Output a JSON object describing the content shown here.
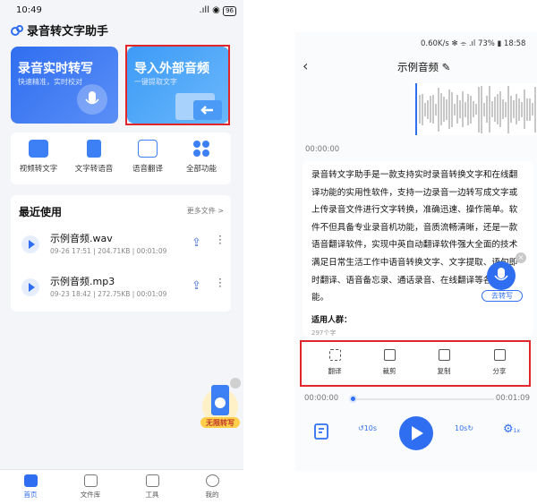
{
  "left": {
    "status": {
      "time": "10:49",
      "battery": "96"
    },
    "app_title": "录音转文字助手",
    "card_record": {
      "title": "录音实时转写",
      "subtitle": "快速精准，实时校对"
    },
    "card_import": {
      "title": "导入外部音频",
      "subtitle": "一键提取文字"
    },
    "tools": [
      {
        "label": "视频转文字",
        "icon": "video-icon"
      },
      {
        "label": "文字转语音",
        "icon": "text-to-speech-icon"
      },
      {
        "label": "语音翻译",
        "icon": "translate-icon"
      },
      {
        "label": "全部功能",
        "icon": "grid-icon"
      }
    ],
    "recent": {
      "title": "最近使用",
      "more": "更多文件 >",
      "items": [
        {
          "name": "示例音频.wav",
          "meta": "09-26 17:51 | 204.71KB | 00:01:09"
        },
        {
          "name": "示例音频.mp3",
          "meta": "09-23 18:42 | 272.75KB | 00:01:09"
        }
      ]
    },
    "promo": "无限转写",
    "nav": [
      {
        "label": "首页",
        "icon": "home-icon"
      },
      {
        "label": "文件库",
        "icon": "folder-icon"
      },
      {
        "label": "工具",
        "icon": "toolbox-icon"
      },
      {
        "label": "我的",
        "icon": "profile-icon"
      }
    ]
  },
  "right": {
    "status": "0.60K/s ✻ ⌯ .ıl 73% ▮ 18:58",
    "title": "示例音频",
    "start_time": "00:00:00",
    "paragraph": "录音转文字助手是一款支持实时录音转换文字和在线翻译功能的实用性软件，支持一边录音一边转写成文字或上传录音文件进行文字转换，准确迅速、操作简单。软件不但具备专业录音机功能，音质流畅清晰，还是一款语音翻译软件，实现中英自动翻译软件强大全面的技术满足日常生活工作中语音转换文字、文字提取、语句即时翻译、语音备忘录、通话录音、在线翻译等各种功能。",
    "tail": "适用人群：",
    "char_count": "297个字",
    "go_transcribe": "去转写",
    "actions": [
      {
        "label": "翻译",
        "icon": "translate-icon"
      },
      {
        "label": "裁剪",
        "icon": "crop-icon"
      },
      {
        "label": "复制",
        "icon": "copy-icon"
      },
      {
        "label": "分享",
        "icon": "share-icon"
      }
    ],
    "progress": {
      "current": "00:00:00",
      "total": "00:01:09",
      "fraction": 0.0
    },
    "skip_back": "10s",
    "skip_forward": "10s",
    "speed": "1x"
  }
}
